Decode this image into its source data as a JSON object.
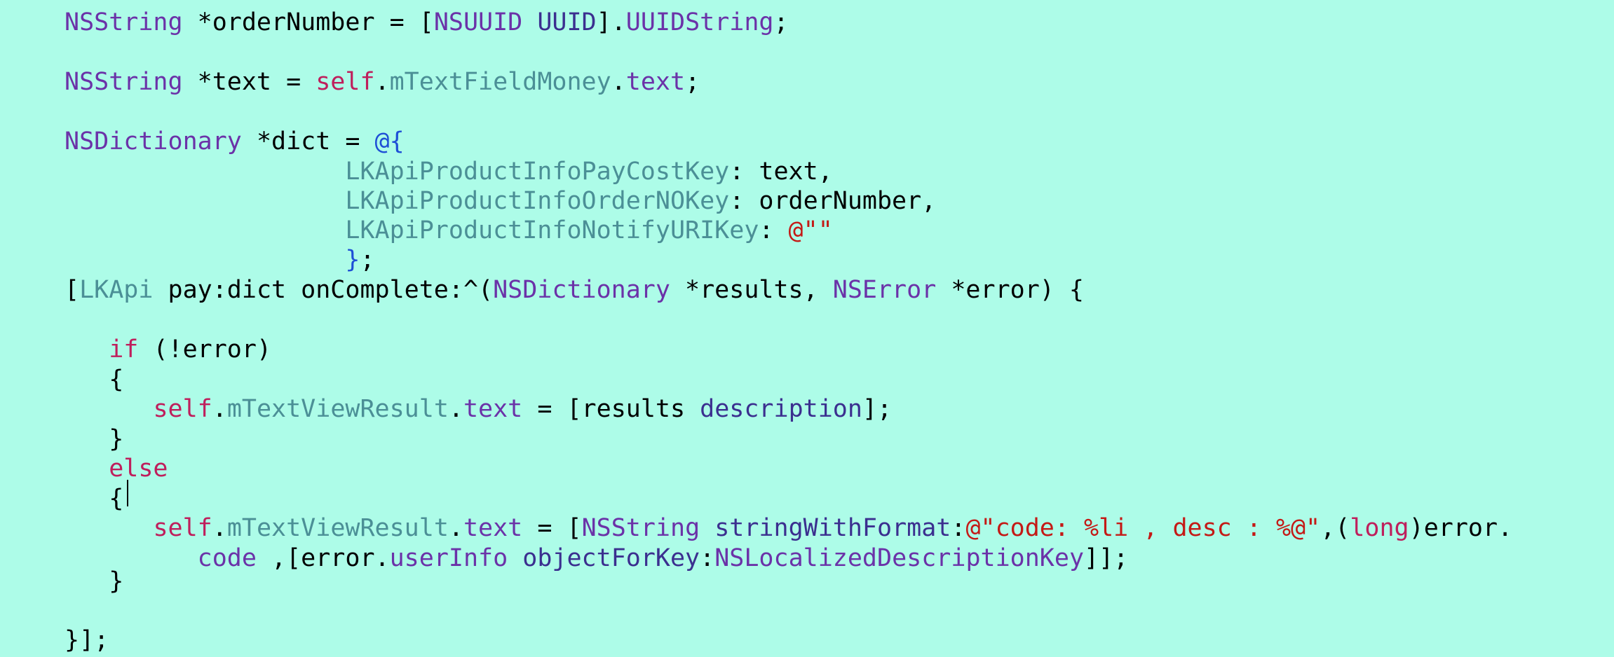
{
  "editor": {
    "background": "#adfce8",
    "token_colors": {
      "plain": "#000000",
      "type": "#6b32a8",
      "method": "#3b2f8f",
      "property": "#4b8f96",
      "keyword": "#bf1f5c",
      "literal": "#1e4fd6",
      "string": "#c41a16"
    },
    "lines": [
      [
        {
          "t": "NSString",
          "c": "type"
        },
        {
          "t": " *orderNumber = [",
          "c": "plain"
        },
        {
          "t": "NSUUID",
          "c": "type"
        },
        {
          "t": " ",
          "c": "plain"
        },
        {
          "t": "UUID",
          "c": "method"
        },
        {
          "t": "].",
          "c": "plain"
        },
        {
          "t": "UUIDString",
          "c": "type"
        },
        {
          "t": ";",
          "c": "plain"
        }
      ],
      [],
      [
        {
          "t": "NSString",
          "c": "type"
        },
        {
          "t": " *text = ",
          "c": "plain"
        },
        {
          "t": "self",
          "c": "keyword"
        },
        {
          "t": ".",
          "c": "plain"
        },
        {
          "t": "mTextFieldMoney",
          "c": "property"
        },
        {
          "t": ".",
          "c": "plain"
        },
        {
          "t": "text",
          "c": "type"
        },
        {
          "t": ";",
          "c": "plain"
        }
      ],
      [],
      [
        {
          "t": "NSDictionary",
          "c": "type"
        },
        {
          "t": " *dict = ",
          "c": "plain"
        },
        {
          "t": "@{",
          "c": "literal"
        }
      ],
      [
        {
          "t": "                   ",
          "c": "plain"
        },
        {
          "t": "LKApiProductInfoPayCostKey",
          "c": "property"
        },
        {
          "t": ": text,",
          "c": "plain"
        }
      ],
      [
        {
          "t": "                   ",
          "c": "plain"
        },
        {
          "t": "LKApiProductInfoOrderNOKey",
          "c": "property"
        },
        {
          "t": ": orderNumber,",
          "c": "plain"
        }
      ],
      [
        {
          "t": "                   ",
          "c": "plain"
        },
        {
          "t": "LKApiProductInfoNotifyURIKey",
          "c": "property"
        },
        {
          "t": ": ",
          "c": "plain"
        },
        {
          "t": "@\"\"",
          "c": "string"
        }
      ],
      [
        {
          "t": "                   ",
          "c": "plain"
        },
        {
          "t": "}",
          "c": "literal"
        },
        {
          "t": ";",
          "c": "plain"
        }
      ],
      [
        {
          "t": "[",
          "c": "plain"
        },
        {
          "t": "LKApi",
          "c": "property"
        },
        {
          "t": " pay:dict onComplete:^(",
          "c": "plain"
        },
        {
          "t": "NSDictionary",
          "c": "type"
        },
        {
          "t": " *results, ",
          "c": "plain"
        },
        {
          "t": "NSError",
          "c": "type"
        },
        {
          "t": " *error) {",
          "c": "plain"
        }
      ],
      [],
      [
        {
          "t": "   ",
          "c": "plain"
        },
        {
          "t": "if",
          "c": "keyword"
        },
        {
          "t": " (!error)",
          "c": "plain"
        }
      ],
      [
        {
          "t": "   {",
          "c": "plain"
        }
      ],
      [
        {
          "t": "      ",
          "c": "plain"
        },
        {
          "t": "self",
          "c": "keyword"
        },
        {
          "t": ".",
          "c": "plain"
        },
        {
          "t": "mTextViewResult",
          "c": "property"
        },
        {
          "t": ".",
          "c": "plain"
        },
        {
          "t": "text",
          "c": "type"
        },
        {
          "t": " = [results ",
          "c": "plain"
        },
        {
          "t": "description",
          "c": "method"
        },
        {
          "t": "];",
          "c": "plain"
        }
      ],
      [
        {
          "t": "   }",
          "c": "plain"
        }
      ],
      [
        {
          "t": "   ",
          "c": "plain"
        },
        {
          "t": "else",
          "c": "keyword"
        }
      ],
      [
        {
          "t": "   {",
          "c": "plain"
        }
      ],
      [
        {
          "t": "      ",
          "c": "plain"
        },
        {
          "t": "self",
          "c": "keyword"
        },
        {
          "t": ".",
          "c": "plain"
        },
        {
          "t": "mTextViewResult",
          "c": "property"
        },
        {
          "t": ".",
          "c": "plain"
        },
        {
          "t": "text",
          "c": "type"
        },
        {
          "t": " = [",
          "c": "plain"
        },
        {
          "t": "NSString",
          "c": "type"
        },
        {
          "t": " ",
          "c": "plain"
        },
        {
          "t": "stringWithFormat",
          "c": "method"
        },
        {
          "t": ":",
          "c": "plain"
        },
        {
          "t": "@\"code: %li , desc : %@\"",
          "c": "string"
        },
        {
          "t": ",(",
          "c": "plain"
        },
        {
          "t": "long",
          "c": "keyword"
        },
        {
          "t": ")error.",
          "c": "plain"
        }
      ],
      [
        {
          "t": "         ",
          "c": "plain"
        },
        {
          "t": "code",
          "c": "type"
        },
        {
          "t": " ,[error.",
          "c": "plain"
        },
        {
          "t": "userInfo",
          "c": "type"
        },
        {
          "t": " ",
          "c": "plain"
        },
        {
          "t": "objectForKey",
          "c": "method"
        },
        {
          "t": ":",
          "c": "plain"
        },
        {
          "t": "NSLocalizedDescriptionKey",
          "c": "type"
        },
        {
          "t": "]];",
          "c": "plain"
        }
      ],
      [
        {
          "t": "   }",
          "c": "plain"
        }
      ],
      [],
      [
        {
          "t": "}];",
          "c": "plain"
        }
      ]
    ]
  }
}
